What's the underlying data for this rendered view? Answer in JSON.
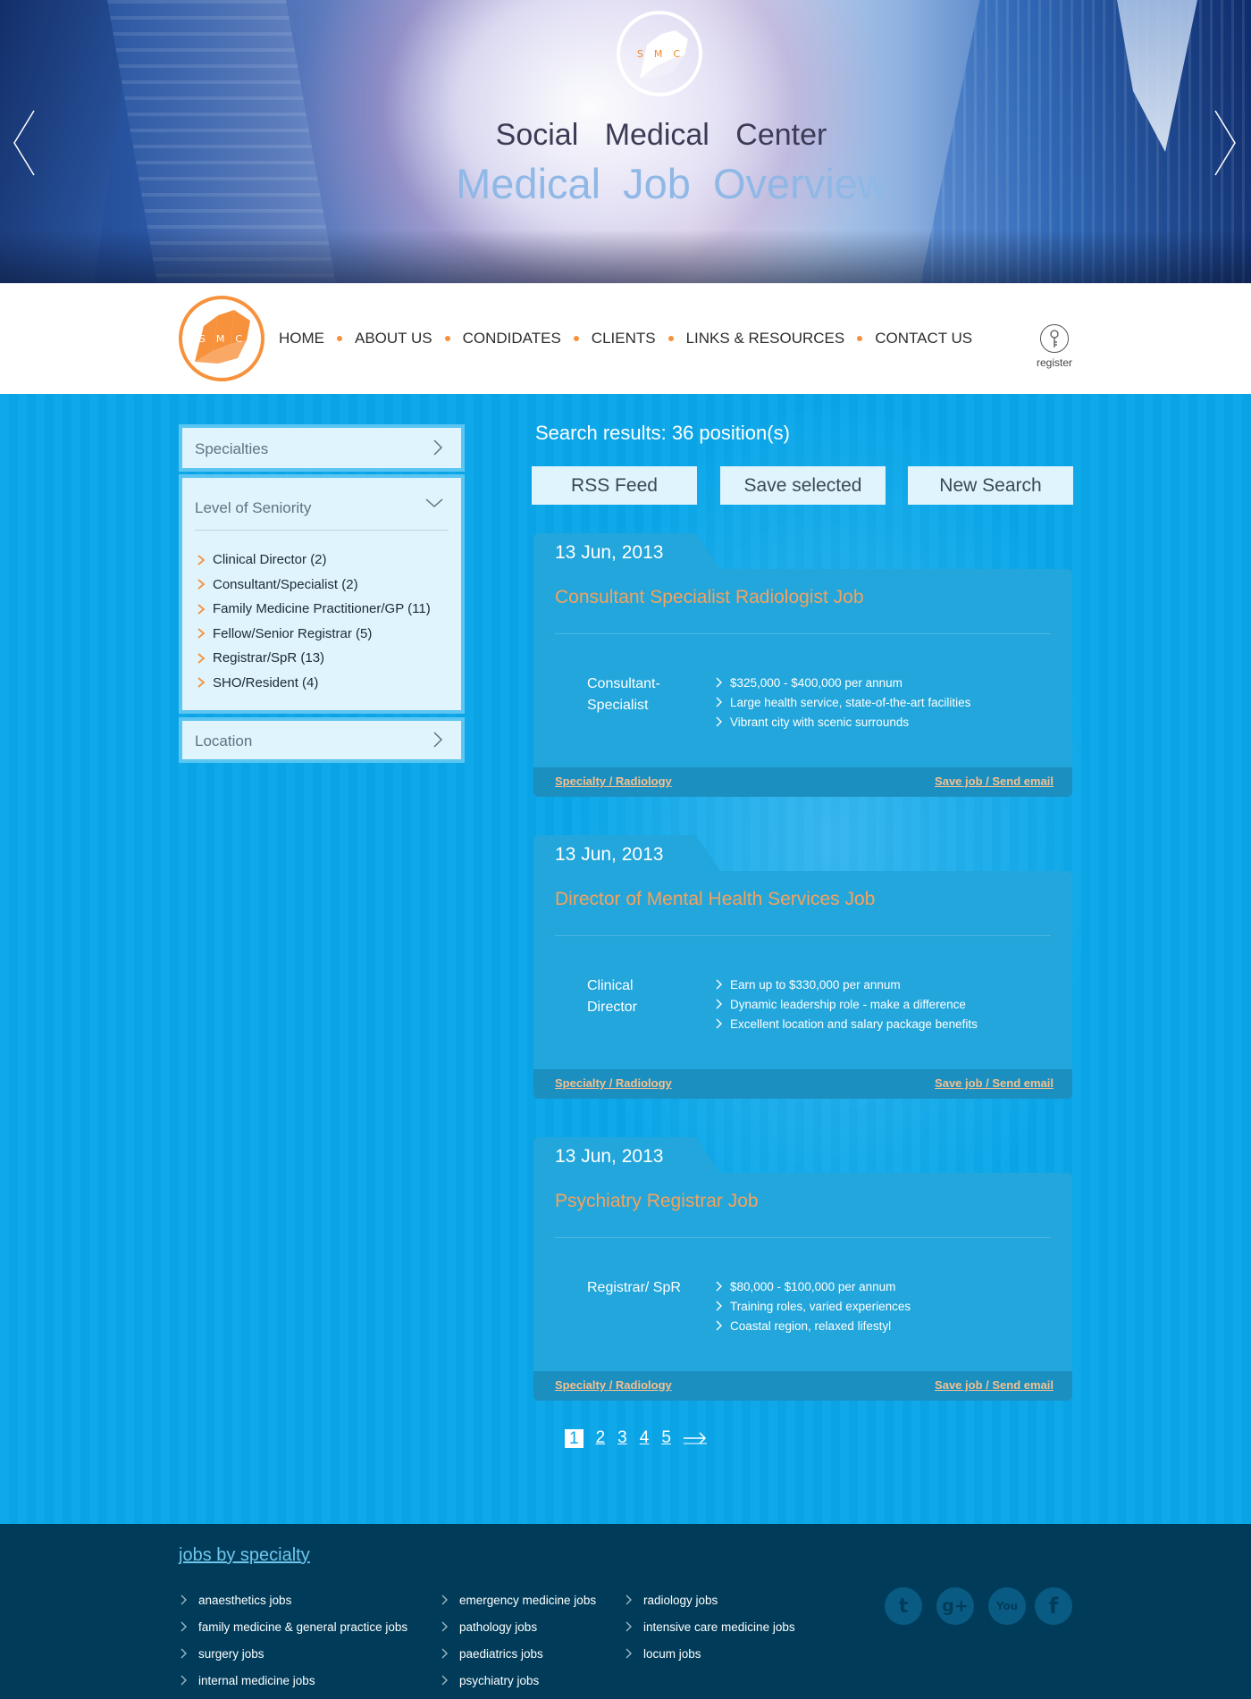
{
  "hero": {
    "logo_letters": "SMC",
    "title_line1": "Social Medical Center",
    "title_line2": "Medical Job Overview",
    "prev_icon": "chevron-left-icon",
    "next_icon": "chevron-right-icon"
  },
  "nav": {
    "logo_letters": "SMC",
    "items": [
      {
        "label": "HOME"
      },
      {
        "label": "ABOUT US"
      },
      {
        "label": "CONDIDATES"
      },
      {
        "label": "CLIENTS"
      },
      {
        "label": "LINKS & RESOURCES"
      },
      {
        "label": "CONTACT US"
      }
    ],
    "register_label": "register",
    "register_icon": "key-icon",
    "accent": "#f7913c"
  },
  "sidebar": {
    "specialties": "Specialties",
    "seniority": {
      "title": "Level of Seniority",
      "items": [
        {
          "label": "Clinical Director (2)"
        },
        {
          "label": "Consultant/Specialist (2)"
        },
        {
          "label": "Family Medicine Practitioner/GP (11)"
        },
        {
          "label": "Fellow/Senior Registrar (5)"
        },
        {
          "label": "Registrar/SpR (13)"
        },
        {
          "label": "SHO/Resident (4)"
        }
      ]
    },
    "location": "Location"
  },
  "results": {
    "title": "Search results: 36 position(s)",
    "buttons": {
      "rss": "RSS Feed",
      "save": "Save selected",
      "new_search": "New Search"
    }
  },
  "jobs": [
    {
      "date": "13 Jun, 2013",
      "title": "Consultant Specialist Radiologist Job",
      "level": "Consultant- Specialist",
      "bullets": [
        "$325,000 - $400,000 per annum",
        "Large health service, state-of-the-art facilities",
        "Vibrant city with scenic surrounds"
      ],
      "specialty_link": "Specialty / Radiology",
      "save_link": "Save job / Send email"
    },
    {
      "date": "13 Jun, 2013",
      "title": "Director of Mental Health Services Job",
      "level": "Clinical Director",
      "bullets": [
        "Earn up to $330,000 per annum",
        "Dynamic leadership role - make a difference",
        "Excellent location and salary package benefits"
      ],
      "specialty_link": "Specialty / Radiology",
      "save_link": "Save job / Send email"
    },
    {
      "date": "13 Jun, 2013",
      "title": "Psychiatry Registrar Job",
      "level": "Registrar/ SpR",
      "bullets": [
        "$80,000 - $100,000 per annum",
        "Training roles, varied experiences",
        "Coastal region, relaxed lifestyl"
      ],
      "specialty_link": "Specialty / Radiology",
      "save_link": "Save job / Send email"
    }
  ],
  "pagination": {
    "pages": [
      "1",
      "2",
      "3",
      "4",
      "5"
    ],
    "current": "1",
    "next_icon": "arrow-right-icon"
  },
  "footer": {
    "title": "jobs by specialty",
    "columns": [
      [
        "anaesthetics jobs",
        "family medicine & general practice jobs",
        "surgery jobs",
        "internal medicine jobs"
      ],
      [
        "emergency medicine jobs",
        "pathology jobs",
        "paediatrics jobs",
        "psychiatry jobs"
      ],
      [
        "radiology jobs",
        "intensive care medicine jobs",
        "locum jobs"
      ]
    ],
    "social": [
      {
        "icon": "twitter-icon",
        "glyph": "t"
      },
      {
        "icon": "google-plus-icon",
        "glyph": "g+"
      },
      {
        "icon": "youtube-icon",
        "glyph": "You"
      },
      {
        "icon": "facebook-icon",
        "glyph": "f"
      }
    ]
  },
  "colors": {
    "main_bg": "#0aa7ea",
    "accent_orange": "#f7913c",
    "job_title": "#f5a25c",
    "footer_bg": "#003c5a"
  }
}
